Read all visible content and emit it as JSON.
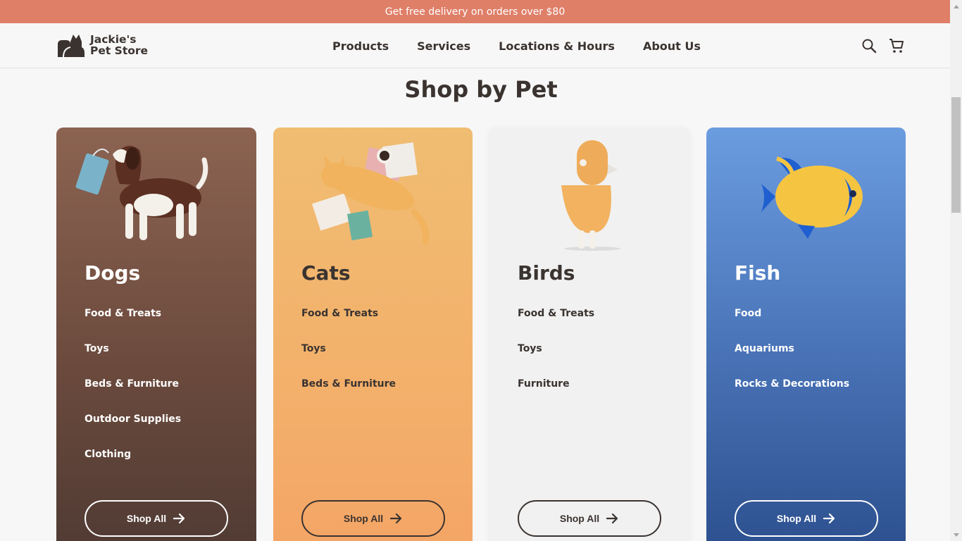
{
  "promo": {
    "text": "Get free delivery on orders over $80"
  },
  "brand": {
    "line1": "Jackie's",
    "line2": "Pet Store"
  },
  "nav": [
    {
      "label": "Products"
    },
    {
      "label": "Services"
    },
    {
      "label": "Locations & Hours"
    },
    {
      "label": "About Us"
    }
  ],
  "header_icons": {
    "search": "search-icon",
    "cart": "cart-icon"
  },
  "section": {
    "title": "Shop by Pet"
  },
  "cards": [
    {
      "title": "Dogs",
      "links": [
        "Food & Treats",
        "Toys",
        "Beds & Furniture",
        "Outdoor Supplies",
        "Clothing"
      ],
      "button": "Shop All"
    },
    {
      "title": "Cats",
      "links": [
        "Food & Treats",
        "Toys",
        "Beds & Furniture"
      ],
      "button": "Shop All"
    },
    {
      "title": "Birds",
      "links": [
        "Food & Treats",
        "Toys",
        "Furniture"
      ],
      "button": "Shop All"
    },
    {
      "title": "Fish",
      "links": [
        "Food",
        "Aquariums",
        "Rocks & Decorations"
      ],
      "button": "Shop All"
    }
  ],
  "colors": {
    "promo": "#df7f68",
    "dogs": "#7a5445",
    "cats": "#f2b46d",
    "birds": "#f1f1f1",
    "fish": "#4a74b8",
    "text_dark": "#3a3330"
  }
}
